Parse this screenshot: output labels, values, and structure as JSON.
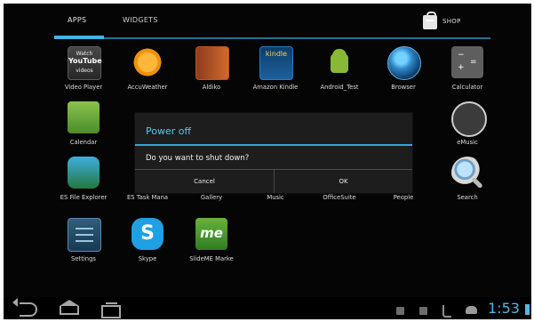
{
  "tabs": {
    "apps": "APPS",
    "widgets": "WIDGETS",
    "shop": "SHOP"
  },
  "apps": {
    "video_player": "Video Player",
    "accuweather": "AccuWeather",
    "aldiko": "Aldiko",
    "amazon_kindle": "Amazon Kindle",
    "android_test": "Android_Test",
    "browser": "Browser",
    "calculator": "Calculator",
    "calendar": "Calendar",
    "emusic": "eMusic",
    "es_file_explorer": "ES File Explorer",
    "es_task_manager": "ES Task Mana",
    "gallery": "Gallery",
    "music": "Music",
    "officesuite": "OfficeSuite",
    "people": "People",
    "search": "Search",
    "settings": "Settings",
    "skype": "Skype",
    "slideme_market": "SlideME Marke"
  },
  "icon_text": {
    "video_player": [
      "Watch",
      "YouTube",
      "videos"
    ],
    "kindle": "kindle",
    "calculator": [
      "−",
      "=",
      "+",
      "="
    ],
    "skype": "S",
    "slideme": "me"
  },
  "dialog": {
    "title": "Power off",
    "message": "Do you want to shut down?",
    "cancel": "Cancel",
    "ok": "OK"
  },
  "status": {
    "time": "1:53"
  },
  "icons": {
    "shop": "shopping-bag-icon",
    "back": "back-icon",
    "home": "home-icon",
    "recent": "recent-apps-icon",
    "usb": "usb-icon",
    "android_debug": "android-icon",
    "battery": "battery-icon"
  },
  "colors": {
    "accent": "#45b5e6",
    "dialog_title": "#5ac7ef",
    "background": "#050505"
  }
}
